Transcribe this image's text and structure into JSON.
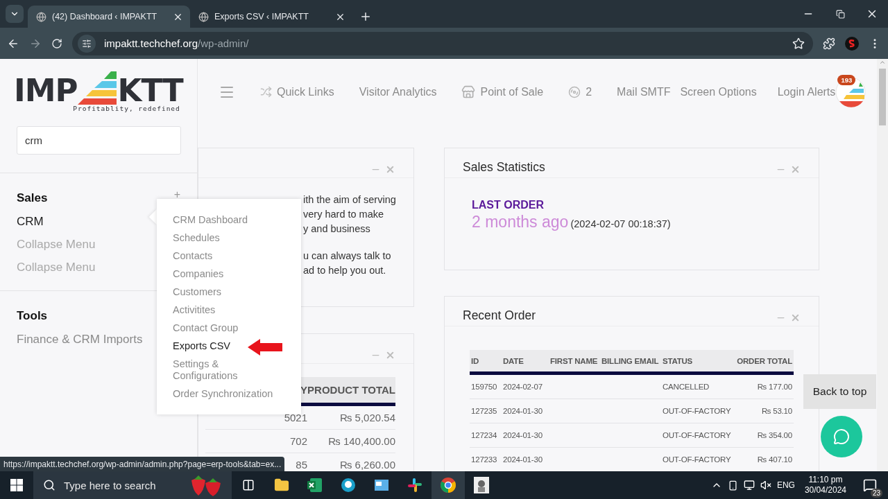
{
  "browser": {
    "tabs": [
      {
        "title": "(42) Dashboard ‹ IMPAKTT",
        "selected": true
      },
      {
        "title": "Exports CSV ‹ IMPAKTT",
        "selected": false
      }
    ],
    "address": {
      "host": "impaktt.techchef.org",
      "path": "/wp-admin/"
    }
  },
  "sidebar": {
    "logo": {
      "left": "IMP",
      "right": "KTT",
      "tagline": "Profitablity, redefined"
    },
    "search": {
      "value": "crm"
    },
    "sections": [
      {
        "title": "Sales",
        "toggle": "+",
        "items": [
          {
            "label": "CRM",
            "kind": "active"
          },
          {
            "label": "Collapse Menu",
            "kind": "muted"
          },
          {
            "label": "Collapse Menu",
            "kind": "muted"
          }
        ]
      },
      {
        "title": "Tools",
        "items": [
          {
            "label": "Finance & CRM Imports",
            "kind": "link"
          }
        ]
      }
    ]
  },
  "header_nav": [
    {
      "kind": "menu"
    },
    {
      "kind": "shuffle",
      "label": "Quick Links"
    },
    {
      "kind": "text",
      "label": "Visitor Analytics"
    },
    {
      "kind": "store",
      "label": "Point of Sale"
    },
    {
      "kind": "reel",
      "label": "2"
    },
    {
      "kind": "text",
      "label": "Mail SMTF"
    },
    {
      "kind": "text",
      "label": "Screen Options"
    },
    {
      "kind": "alerts",
      "label": "Login Alerts",
      "badge": "193"
    },
    {
      "kind": "avatar"
    }
  ],
  "flyout": {
    "items": [
      {
        "label": "CRM Dashboard",
        "selected": false
      },
      {
        "label": "Schedules",
        "selected": false
      },
      {
        "label": "Contacts",
        "selected": false
      },
      {
        "label": "Companies",
        "selected": false
      },
      {
        "label": "Customers",
        "selected": false
      },
      {
        "label": "Activitites",
        "selected": false
      },
      {
        "label": "Contact Group",
        "selected": false
      },
      {
        "label": "Exports CSV",
        "selected": true
      },
      {
        "label": "Settings & Configurations",
        "selected": false
      },
      {
        "label": "Order Synchronization",
        "selected": false
      }
    ]
  },
  "about_card": {
    "paragraphs": [
      [
        "ith the aim of serving",
        "very hard to make",
        "y and business"
      ],
      [
        "u can always talk to",
        "ad to help you out."
      ]
    ]
  },
  "products_card": {
    "columns": [
      "Y",
      "PRODUCT TOTAL"
    ],
    "rows": [
      [
        "5021",
        "₨ 5,020.54"
      ],
      [
        "702",
        "₨ 140,400.00"
      ],
      [
        "85",
        "₨ 6,260.00"
      ]
    ]
  },
  "sales_statistics": {
    "title": "Sales Statistics",
    "label": "LAST ORDER",
    "relative": "2 months ago",
    "timestamp": "(2024-02-07 00:18:37)"
  },
  "recent_order": {
    "title": "Recent Order",
    "columns": [
      "ID",
      "DATE",
      "FIRST NAME",
      "BILLING EMAIL",
      "STATUS",
      "ORDER TOTAL"
    ],
    "rows": [
      [
        "159750",
        "2024-02-07",
        "",
        "",
        "CANCELLED",
        "₨ 177.00"
      ],
      [
        "127235",
        "2024-01-30",
        "",
        "",
        "OUT-OF-FACTORY",
        "₨ 53.10"
      ],
      [
        "127234",
        "2024-01-30",
        "",
        "",
        "OUT-OF-FACTORY",
        "₨ 354.00"
      ],
      [
        "127233",
        "2024-01-30",
        "",
        "",
        "OUT-OF-FACTORY",
        "₨ 407.10"
      ]
    ]
  },
  "back_to_top": "Back to top",
  "status_link": "https://impaktt.techchef.org/wp-admin/admin.php?page=erp-tools&tab=ex...",
  "taskbar": {
    "search_placeholder": "Type here to search",
    "language": "ENG",
    "time": "11:10 pm",
    "date": "30/04/2024",
    "notifications": "23"
  }
}
